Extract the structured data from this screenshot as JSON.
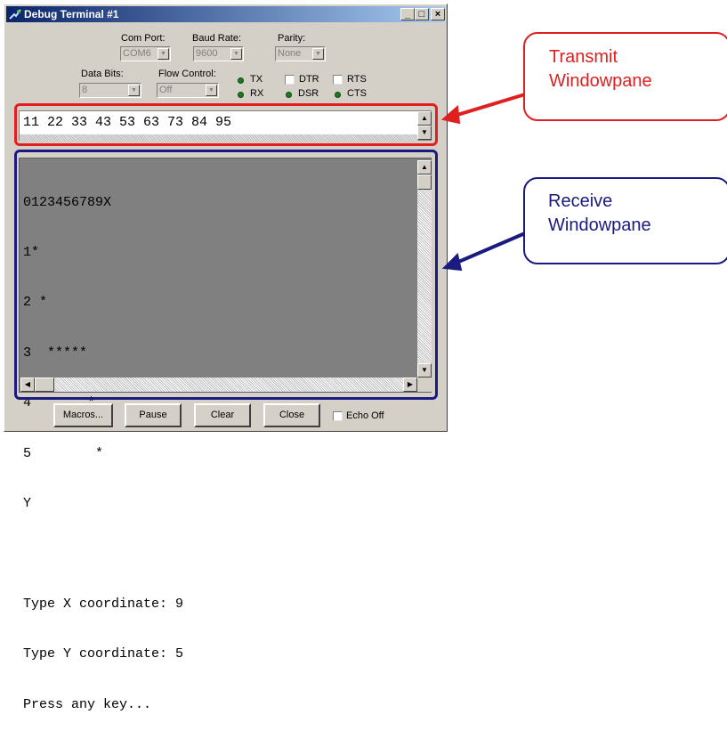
{
  "window": {
    "title": "Debug Terminal #1",
    "controls": {
      "minimize": "_",
      "maximize": "□",
      "close": "×"
    }
  },
  "settings": {
    "com_port": {
      "label": "Com Port:",
      "value": "COM6"
    },
    "baud_rate": {
      "label": "Baud Rate:",
      "value": "9600"
    },
    "parity": {
      "label": "Parity:",
      "value": "None"
    },
    "data_bits": {
      "label": "Data Bits:",
      "value": "8"
    },
    "flow_control": {
      "label": "Flow Control:",
      "value": "Off"
    }
  },
  "indicators": {
    "tx": "TX",
    "rx": "RX",
    "dtr": "DTR",
    "rts": "RTS",
    "dsr": "DSR",
    "cts": "CTS"
  },
  "transmit": {
    "text": "11 22 33 43 53 63 73 84 95"
  },
  "receive": {
    "lines": [
      "0123456789X",
      "1*",
      "2 *",
      "3  *****",
      "4       *",
      "5        *",
      "Y",
      "",
      "Type X coordinate: 9",
      "Type Y coordinate: 5",
      "Press any key..."
    ]
  },
  "buttons": {
    "macros": "Macros...",
    "pause": "Pause",
    "clear": "Clear",
    "close": "Close",
    "echo_off": "Echo Off"
  },
  "annotations": {
    "transmit_line1": "Transmit",
    "transmit_line2": "Windowpane",
    "receive_line1": "Receive",
    "receive_line2": "Windowpane"
  },
  "colors": {
    "transmit_accent": "#e02020",
    "receive_accent": "#1a1a80",
    "title_bar": "#0a246a",
    "led_green": "#1e7a1e"
  }
}
